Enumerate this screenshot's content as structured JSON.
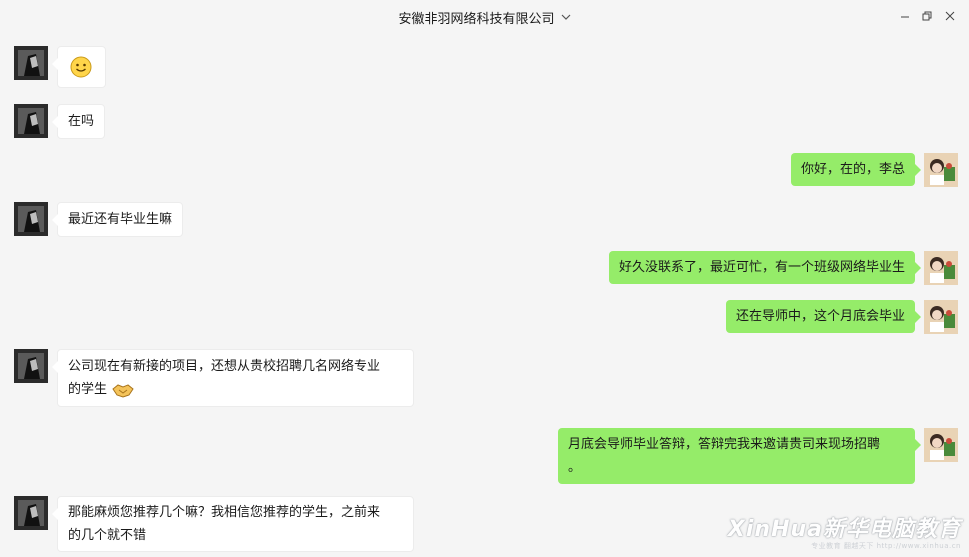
{
  "window": {
    "title": "安徽非羽网络科技有限公司",
    "controls": [
      "minimize-icon",
      "restore-icon",
      "close-icon"
    ]
  },
  "messages": [
    {
      "side": "left",
      "sender": "contact",
      "text": "",
      "emoji": "smile-emoji"
    },
    {
      "side": "left",
      "sender": "contact",
      "text": "在吗"
    },
    {
      "side": "right",
      "sender": "me",
      "text": "你好，在的，李总"
    },
    {
      "side": "left",
      "sender": "contact",
      "text": "最近还有毕业生嘛"
    },
    {
      "side": "right",
      "sender": "me",
      "text": "好久没联系了，最近可忙，有一个班级网络毕业生"
    },
    {
      "side": "right",
      "sender": "me",
      "text": "还在导师中，这个月底会毕业"
    },
    {
      "side": "left",
      "sender": "contact",
      "text_line1": "公司现在有新接的项目，还想从贵校招聘几名网络专业",
      "text_line2": "的学生",
      "emoji": "handshake-emoji"
    },
    {
      "side": "right",
      "sender": "me",
      "text_line1": "月底会导师毕业答辩，答辩完我来邀请贵司来现场招聘",
      "text_line2": "。"
    },
    {
      "side": "left",
      "sender": "contact",
      "text_line1": "那能麻烦您推荐几个嘛？我相信您推荐的学生，之前来",
      "text_line2": "的几个就不错"
    }
  ],
  "watermark": {
    "main": "XinHua新华电脑教育",
    "sub": "专业教育 翻越天下 http://www.xinhua.cn"
  },
  "colors": {
    "background": "#f5f5f5",
    "incoming_bubble": "#ffffff",
    "outgoing_bubble": "#95ec69"
  }
}
